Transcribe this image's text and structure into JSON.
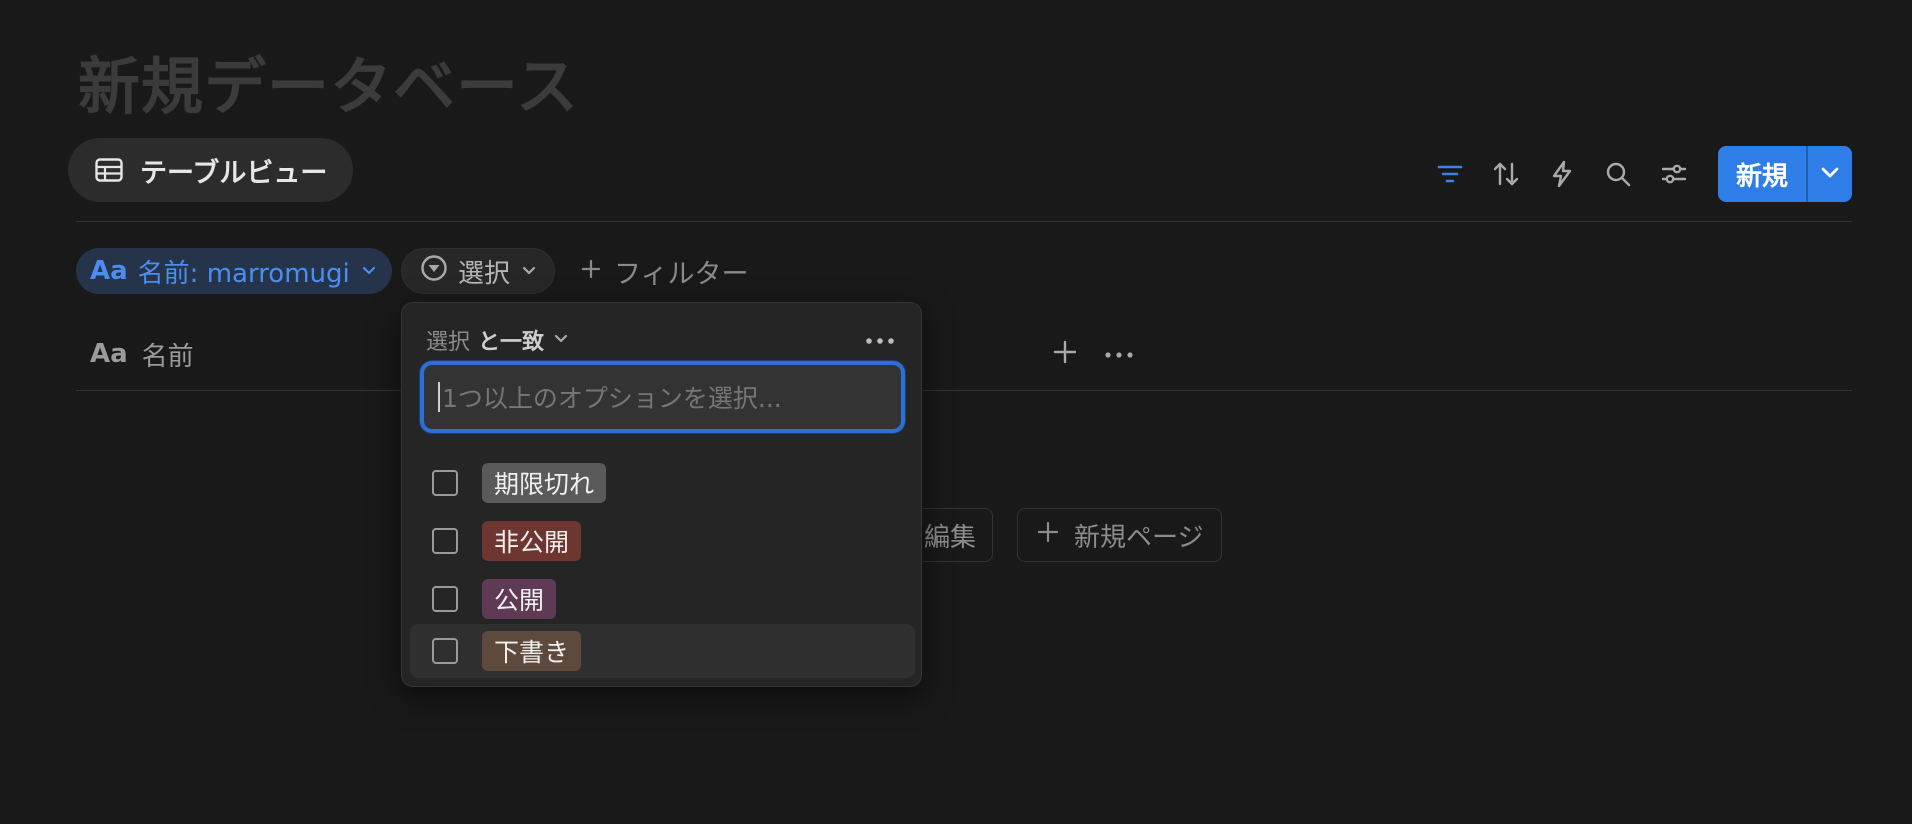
{
  "page": {
    "title": "新規データベース"
  },
  "view_tab": {
    "label": "テーブルビュー",
    "icon": "table-icon"
  },
  "toolbar": {
    "icons": [
      "filter-icon",
      "sort-icon",
      "lightning-icon",
      "search-icon",
      "settings-sliders-icon"
    ],
    "new_label": "新規",
    "accent": "#2f7ee8"
  },
  "filters": {
    "name_chip": {
      "prefix": "Aa",
      "label": "名前: marromugi"
    },
    "select_chip": {
      "label": "選択"
    },
    "add_filter_label": "フィルター"
  },
  "table": {
    "columns": [
      {
        "prefix": "Aa",
        "label": "名前"
      }
    ]
  },
  "empty_state": {
    "edit_label": "編集",
    "new_page_label": "新規ページ"
  },
  "dropdown": {
    "property": "選択",
    "operator": "と一致",
    "search_placeholder": "1つ以上のオプションを選択...",
    "options": [
      {
        "label": "期限切れ",
        "color": "#5a5a5a",
        "checked": false
      },
      {
        "label": "非公開",
        "color": "#6e3630",
        "checked": false
      },
      {
        "label": "公開",
        "color": "#5e3a55",
        "checked": false
      },
      {
        "label": "下書き",
        "color": "#5d4a3c",
        "checked": false
      }
    ]
  }
}
